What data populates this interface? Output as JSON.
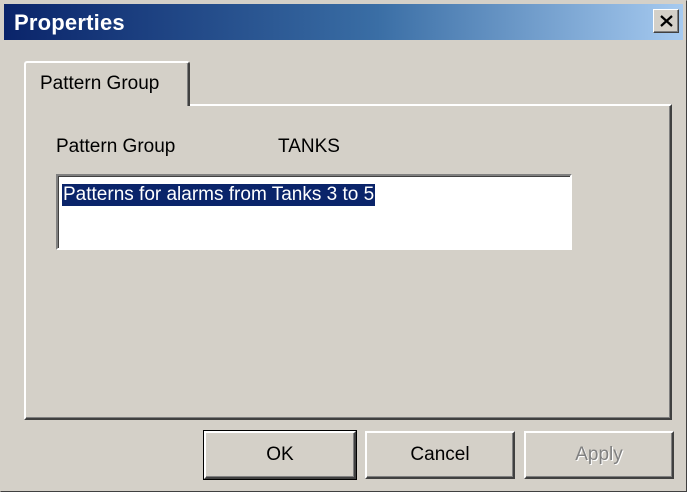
{
  "window": {
    "title": "Properties",
    "close_icon": "close-x-icon"
  },
  "tabs": [
    {
      "label": "Pattern Group",
      "selected": true
    }
  ],
  "panel": {
    "field_label": "Pattern Group",
    "field_value": "TANKS",
    "description": "Patterns for alarms from Tanks 3 to 5"
  },
  "buttons": {
    "ok": "OK",
    "cancel": "Cancel",
    "apply": "Apply"
  },
  "colors": {
    "title_gradient_start": "#0a246a",
    "title_gradient_end": "#a6caf0",
    "face": "#d4d0c8",
    "selection": "#0a246a"
  }
}
